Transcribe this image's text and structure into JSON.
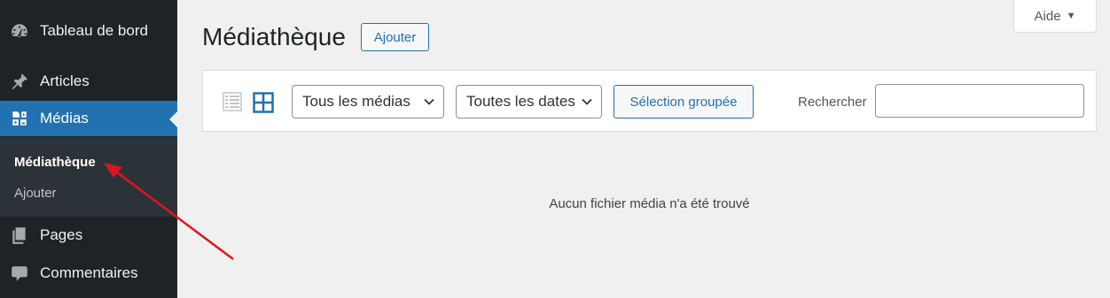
{
  "sidebar": {
    "items": [
      {
        "label": "Tableau de bord",
        "icon": "dashboard-icon"
      },
      {
        "label": "Articles",
        "icon": "pin-icon"
      },
      {
        "label": "Médias",
        "icon": "media-icon",
        "active": true
      },
      {
        "label": "Pages",
        "icon": "pages-icon"
      },
      {
        "label": "Commentaires",
        "icon": "comment-icon"
      }
    ],
    "submenu": [
      {
        "label": "Médiathèque",
        "current": true
      },
      {
        "label": "Ajouter"
      }
    ]
  },
  "header": {
    "title": "Médiathèque",
    "add_label": "Ajouter",
    "help_label": "Aide"
  },
  "toolbar": {
    "view_modes": [
      "list-view-icon",
      "grid-view-icon"
    ],
    "filter_type": {
      "selected": "Tous les médias"
    },
    "filter_date": {
      "selected": "Toutes les dates"
    },
    "bulk_label": "Sélection groupée",
    "search_label": "Rechercher",
    "search_value": ""
  },
  "main": {
    "empty_message": "Aucun fichier média n'a été trouvé"
  },
  "colors": {
    "sidebar_bg": "#1d2327",
    "submenu_bg": "#2c3338",
    "accent": "#2271b1",
    "annotation_arrow": "#e0141e"
  }
}
